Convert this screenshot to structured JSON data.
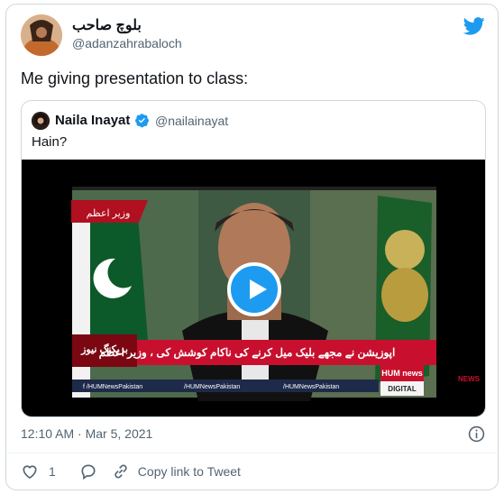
{
  "author": {
    "display_name": "بلوچ صاحب",
    "handle": "@adanzahrabaloch"
  },
  "tweet": {
    "text": "Me giving presentation to class:",
    "timestamp": "12:10 AM · Mar 5, 2021"
  },
  "quoted": {
    "display_name": "Naila Inayat",
    "handle": "@nailainayat",
    "text": "Hain?",
    "video": {
      "channel_label": "وزیر اعظم",
      "ticker_tag": "بریکنگ نیوز",
      "ticker_text": "اپوزیشن نے مجھے بلیک میل کرنے کی ناکام کوشش کی ، وزیر اعظم",
      "logo_text": "HUM news",
      "logo_sub": "DIGITAL",
      "footer_items": [
        "f /HUMNewsPakistan",
        "/HUMNewsPakistan",
        "/HUMNewsPakistan"
      ],
      "corner_text": "NEWS"
    }
  },
  "actions": {
    "like_count": "1",
    "copy_link_label": "Copy link to Tweet"
  },
  "colors": {
    "accent": "#1d9bf0",
    "text": "#0f1419",
    "muted": "#536471",
    "ticker_red": "#c8102e"
  },
  "icons": [
    "twitter-bird-icon",
    "verified-badge-icon",
    "play-icon",
    "info-icon",
    "heart-icon",
    "reply-icon",
    "link-icon"
  ]
}
